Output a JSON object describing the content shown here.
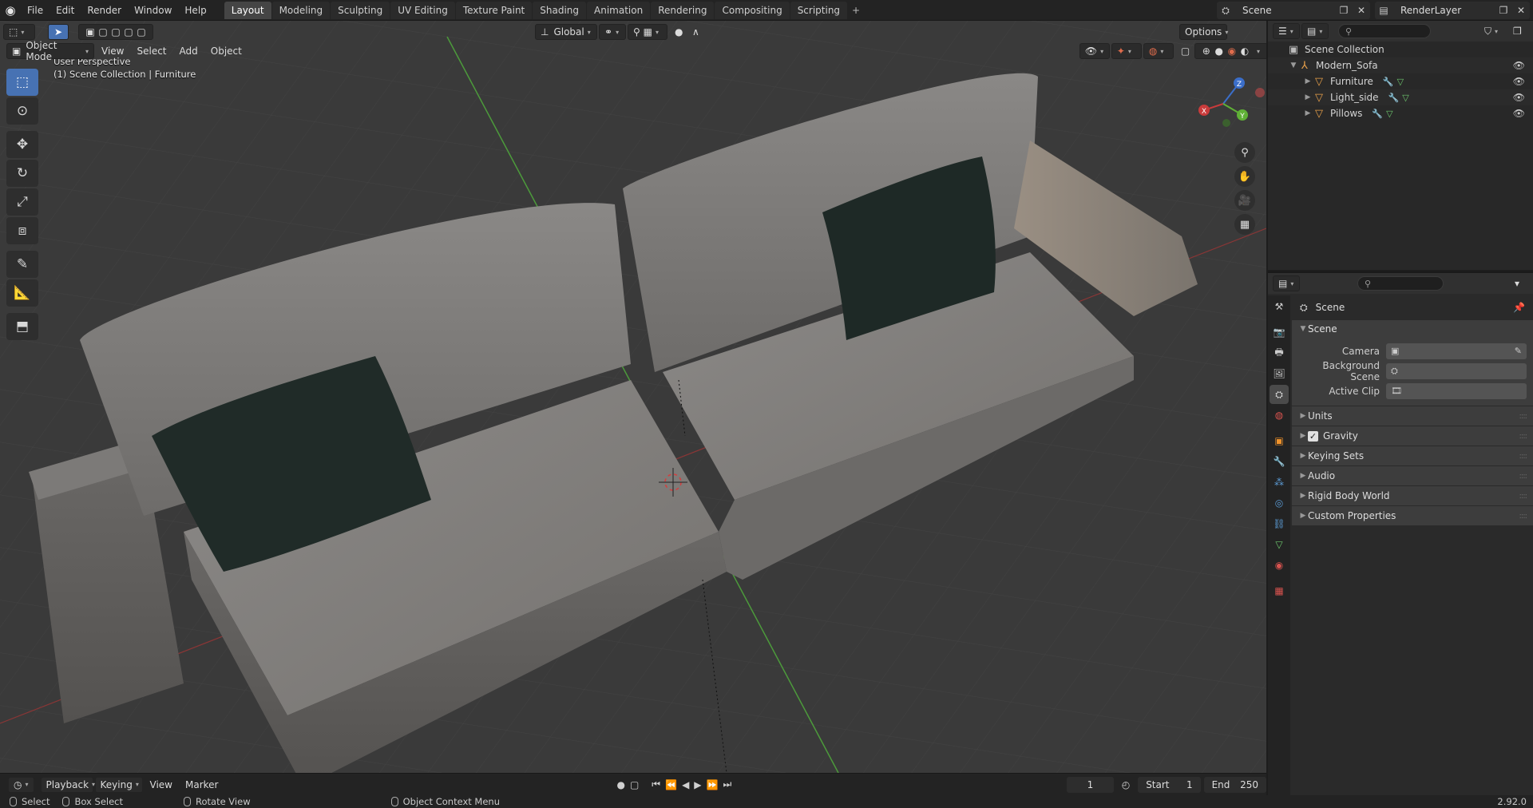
{
  "topbar": {
    "menus": [
      "File",
      "Edit",
      "Render",
      "Window",
      "Help"
    ],
    "workspaces": [
      "Layout",
      "Modeling",
      "Sculpting",
      "UV Editing",
      "Texture Paint",
      "Shading",
      "Animation",
      "Rendering",
      "Compositing",
      "Scripting"
    ],
    "active_workspace": "Layout",
    "add_label": "+",
    "scene_name": "Scene",
    "view_layer": "RenderLayer"
  },
  "viewport": {
    "mode": "Object Mode",
    "menus": [
      "View",
      "Select",
      "Add",
      "Object"
    ],
    "orientation": "Global",
    "options_label": "Options",
    "overlay_line1": "User Perspective",
    "overlay_line2": "(1) Scene Collection | Furniture",
    "gizmo_axes": {
      "x": "X",
      "y": "Y",
      "z": "Z"
    },
    "colors": {
      "background": "#3a3a3a",
      "x_axis": "#b03c3c",
      "y_axis": "#4c9a3b",
      "active": "#4772b3",
      "sofa": "#7a7876",
      "pillow": "#1f2a27"
    }
  },
  "timeline": {
    "playback": "Playback",
    "keying": "Keying",
    "view": "View",
    "marker": "Marker",
    "current_frame": "1",
    "start_label": "Start",
    "start_value": "1",
    "end_label": "End",
    "end_value": "250"
  },
  "statusbar": {
    "select": "Select",
    "box_select": "Box Select",
    "rotate_view": "Rotate View",
    "context_menu": "Object Context Menu",
    "version": "2.92.0"
  },
  "outliner": {
    "root": "Scene Collection",
    "collection": "Modern_Sofa",
    "objects": [
      "Furniture",
      "Light_side",
      "Pillows"
    ]
  },
  "properties": {
    "context": "Scene",
    "panel_scene": "Scene",
    "camera_label": "Camera",
    "background_label": "Background Scene",
    "clip_label": "Active Clip",
    "sub_panels": [
      "Units",
      "Gravity",
      "Keying Sets",
      "Audio",
      "Rigid Body World",
      "Custom Properties"
    ]
  }
}
